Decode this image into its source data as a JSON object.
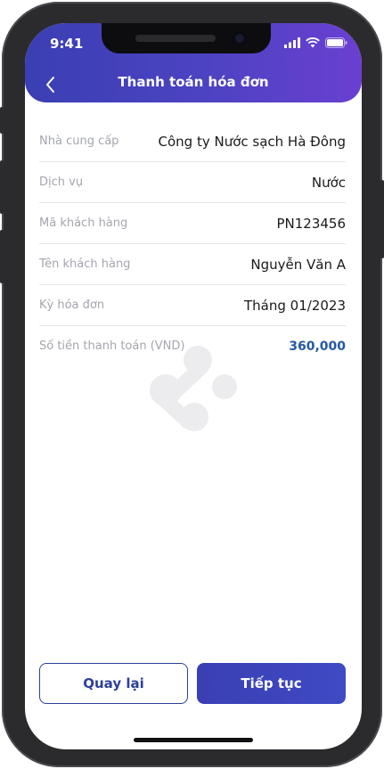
{
  "status_bar": {
    "time": "9:41"
  },
  "header": {
    "title": "Thanh toán hóa đơn"
  },
  "rows": [
    {
      "label": "Nhà cung cấp",
      "value": "Công ty Nước sạch Hà Đông"
    },
    {
      "label": "Dịch vụ",
      "value": "Nước"
    },
    {
      "label": "Mã khách hàng",
      "value": "PN123456"
    },
    {
      "label": "Tên khách hàng",
      "value": "Nguyễn Văn A"
    },
    {
      "label": "Kỳ hóa đơn",
      "value": "Tháng 01/2023"
    },
    {
      "label": "Số tiền thanh toán (VND)",
      "value": "360,000"
    }
  ],
  "buttons": {
    "back_label": "Quay lại",
    "continue_label": "Tiếp tục"
  },
  "colors": {
    "header_start": "#3a3fb3",
    "header_end": "#6a3fd1",
    "amount": "#2458a6",
    "outline": "#2d3f9a"
  },
  "icons": {
    "back": "chevron-left-icon",
    "signal": "signal-icon",
    "wifi": "wifi-icon",
    "battery": "battery-icon",
    "watermark": "share-logo-icon"
  }
}
